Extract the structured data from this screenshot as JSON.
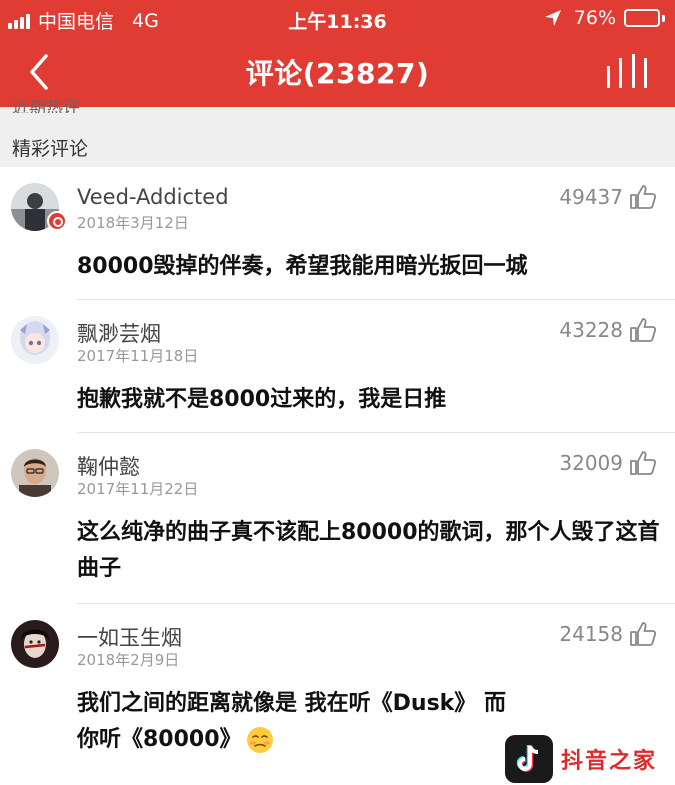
{
  "status_bar": {
    "carrier": "中国电信",
    "network": "4G",
    "time": "上午11:36",
    "battery": "76%",
    "battery_level": 0.76
  },
  "nav": {
    "title": "评论(23827)",
    "back_icon": "chevron-left-icon",
    "menu_icon": "bars-menu-icon"
  },
  "partial_label": "近期热评",
  "section_title": "精彩评论",
  "comments": [
    {
      "username": "Veed-Addicted",
      "date": "2018年3月12日",
      "likes": "49437",
      "text": "80000毁掉的伴奏，希望我能用暗光扳回一城"
    },
    {
      "username": "飘渺芸烟",
      "date": "2017年11月18日",
      "likes": "43228",
      "text": "抱歉我就不是8000过来的，我是日推"
    },
    {
      "username": "鞠仲懿",
      "date": "2017年11月22日",
      "likes": "32009",
      "text": "这么纯净的曲子真不该配上80000的歌词，那个人毁了这首曲子"
    },
    {
      "username": "一如玉生烟",
      "date": "2018年2月9日",
      "likes": "24158",
      "text": "我们之间的距离就像是  我在听《Dusk》 而你听《80000》"
    }
  ],
  "watermark": {
    "text": "抖音之家"
  },
  "colors": {
    "brand_red": "#e03c34",
    "watermark_red": "#e02a2a"
  }
}
